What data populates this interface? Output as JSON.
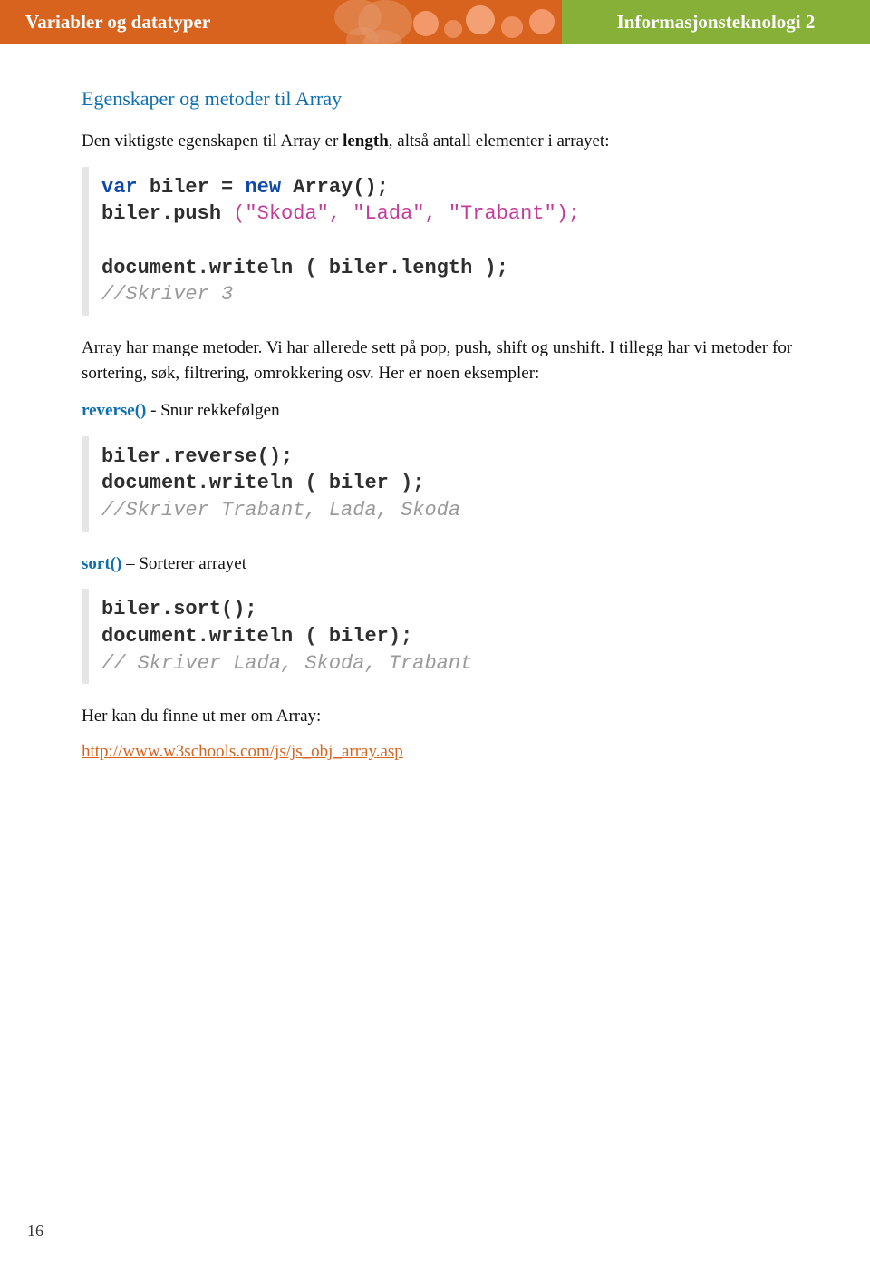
{
  "header": {
    "left": "Variabler og datatyper",
    "right": "Informasjonsteknologi 2"
  },
  "section": {
    "heading": "Egenskaper og metoder til Array",
    "intro_prefix": "Den viktigste egenskapen til Array er ",
    "intro_term": "length",
    "intro_suffix": ", altså antall elementer i arrayet:"
  },
  "code1": {
    "l1_var": "var",
    "l1_name": "biler",
    "l1_eq": " = ",
    "l1_new": "new",
    "l1_arr": " Array();",
    "l2_obj": "biler",
    "l2_dot": ".",
    "l2_method": "push",
    "l2_args": " (\"Skoda\", \"Lada\", \"Trabant\");",
    "l3": "",
    "l4_obj": "document",
    "l4_method": ".writeln",
    "l4_open": " ( ",
    "l4_arg": "biler",
    "l4_prop": ".length",
    "l4_close": " );",
    "l5_comment": "//Skriver 3"
  },
  "mid_para": "Array har mange metoder. Vi har allerede sett på pop, push, shift og unshift. I tillegg har vi metoder for sortering, søk, filtrering, omrokkering osv. Her er noen eksempler:",
  "reverse": {
    "label": "reverse()",
    "desc": " - Snur rekkefølgen"
  },
  "code2": {
    "l1_obj": "biler",
    "l1_rest": ".reverse();",
    "l2_obj": "document",
    "l2_method": ".writeln",
    "l2_open": " ( ",
    "l2_arg": "biler",
    "l2_close": " );",
    "l3_comment": "//Skriver Trabant, Lada, Skoda"
  },
  "sort": {
    "label": "sort()",
    "desc": " – Sorterer arrayet"
  },
  "code3": {
    "l1_obj": "biler",
    "l1_rest": ".sort();",
    "l2_obj": "document",
    "l2_method": ".writeln",
    "l2_open": " ( ",
    "l2_arg": "biler",
    "l2_close": ");",
    "l3_comment": "// Skriver Lada, Skoda, Trabant"
  },
  "footer": {
    "text": "Her kan du finne ut mer om Array:",
    "link": "http://www.w3schools.com/js/js_obj_array.asp"
  },
  "page_number": "16"
}
